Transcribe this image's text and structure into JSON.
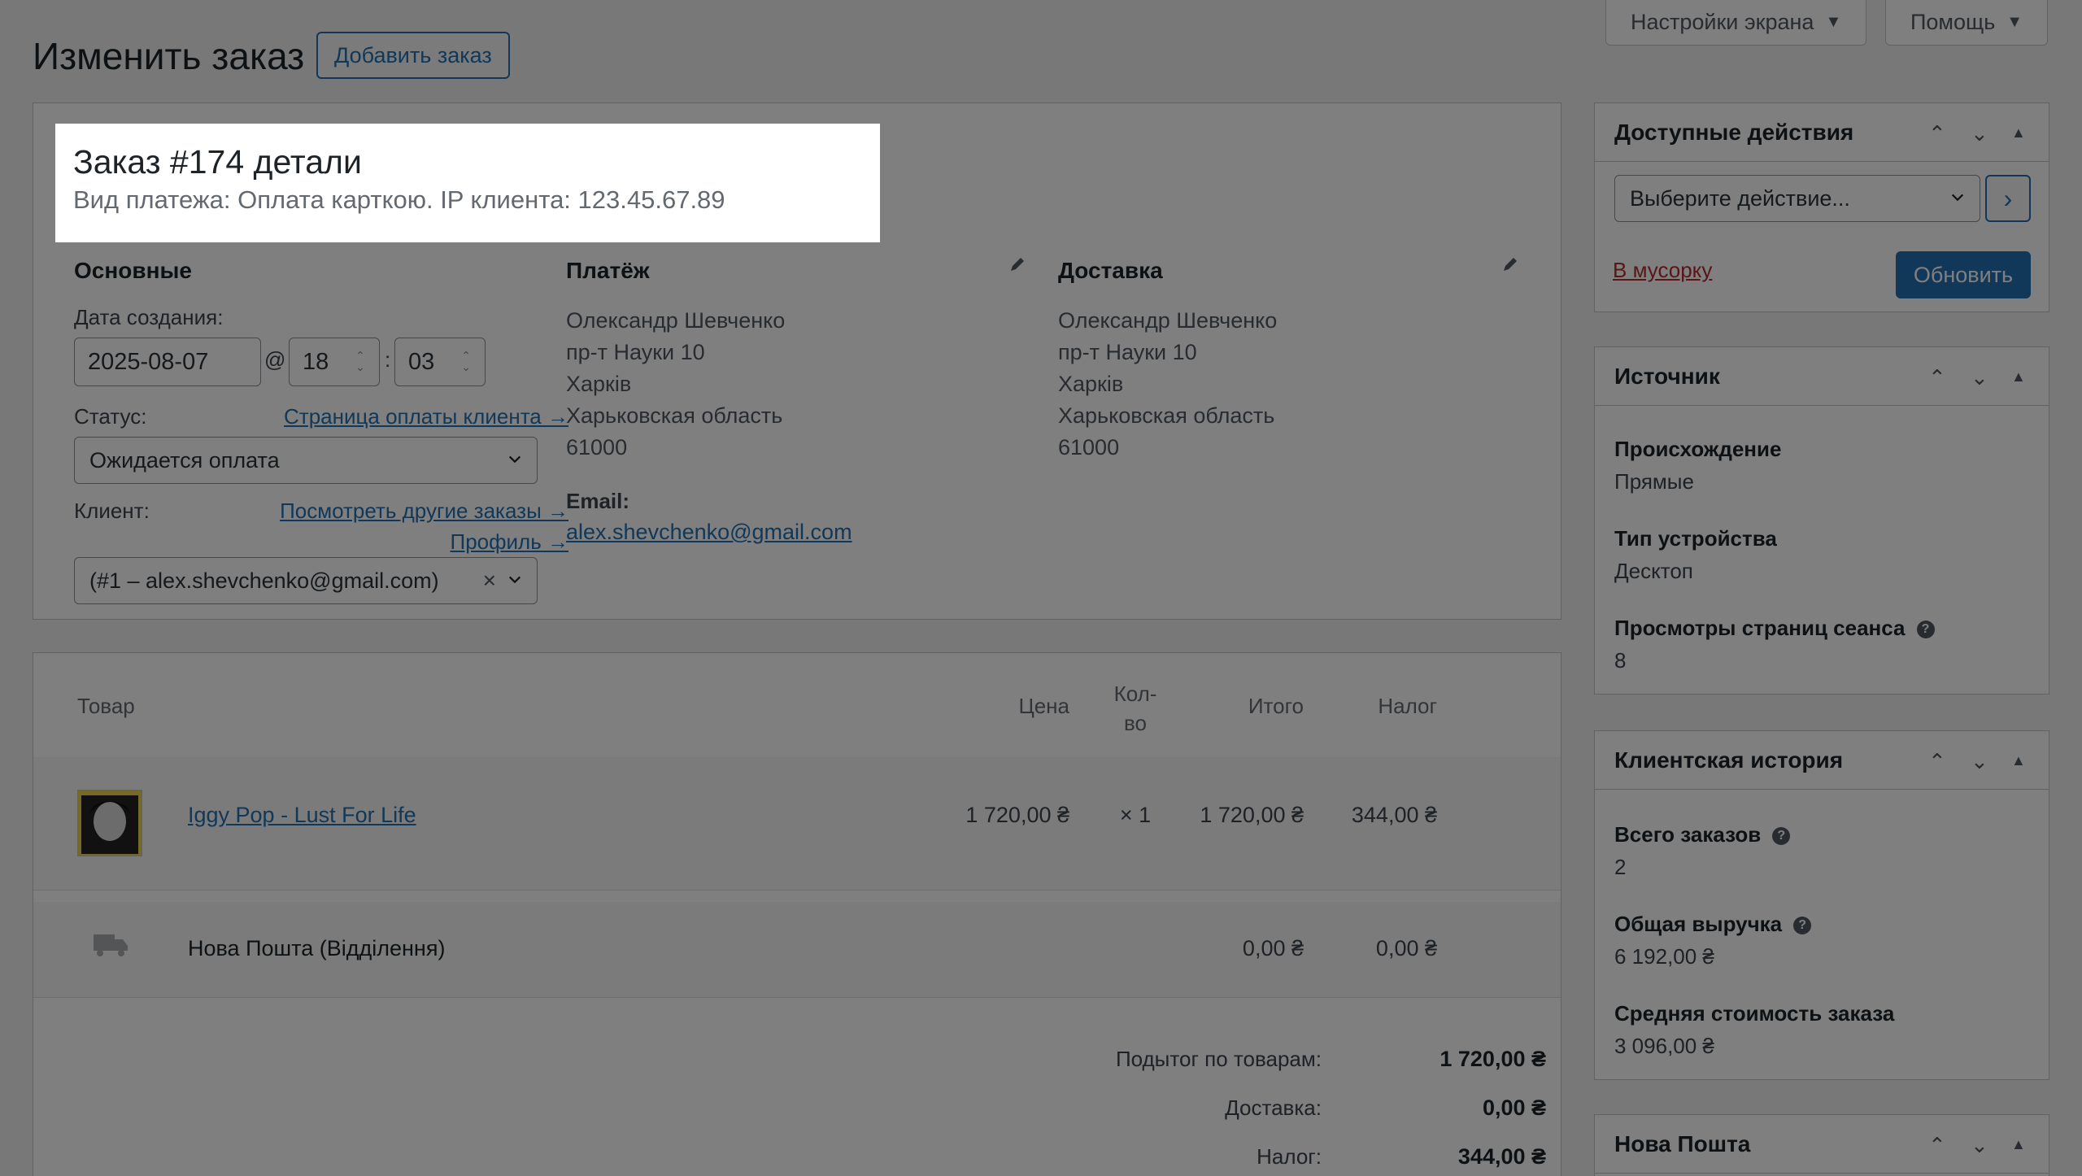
{
  "header": {
    "page_title": "Изменить заказ",
    "add_order_button": "Добавить заказ",
    "screen_options": "Настройки экрана",
    "help": "Помощь"
  },
  "order": {
    "title": "Заказ #174 детали",
    "subtitle": "Вид платежа: Оплата карткою. IP клиента: 123.45.67.89",
    "general": {
      "heading": "Основные",
      "date_label": "Дата создания:",
      "date": "2025-08-07",
      "at": "@",
      "hour": "18",
      "colon": ":",
      "minute": "03",
      "status_label": "Статус:",
      "payment_page_link": "Страница оплаты клиента →",
      "status_value": "Ожидается оплата",
      "customer_label": "Клиент:",
      "other_orders_link": "Посмотреть другие заказы →",
      "profile_link": "Профиль →",
      "customer_value": "(#1 – alex.shevchenko@gmail.com)",
      "clear": "×"
    },
    "billing": {
      "heading": "Платёж",
      "lines": [
        "Олександр Шевченко",
        "пр-т Науки 10",
        "Харків",
        "Харьковская область",
        "61000"
      ],
      "email_label": "Email:",
      "email": "alex.shevchenko@gmail.com"
    },
    "shipping": {
      "heading": "Доставка",
      "lines": [
        "Олександр Шевченко",
        "пр-т Науки 10",
        "Харків",
        "Харьковская область",
        "61000"
      ]
    }
  },
  "items": {
    "headers": {
      "product": "Товар",
      "price": "Цена",
      "qty_1": "Кол-",
      "qty_2": "во",
      "total": "Итого",
      "tax": "Налог"
    },
    "rows": [
      {
        "name": "Iggy Pop - Lust For Life",
        "price": "1 720,00 ₴",
        "qty": "× 1",
        "total": "1 720,00 ₴",
        "tax": "344,00 ₴"
      }
    ],
    "shipping_row": {
      "name": "Нова Пошта (Відділення)",
      "total": "0,00 ₴",
      "tax": "0,00 ₴"
    },
    "summary": [
      {
        "label": "Подытог по товарам:",
        "value": "1 720,00 ₴"
      },
      {
        "label": "Доставка:",
        "value": "0,00 ₴"
      },
      {
        "label": "Налог:",
        "value": "344,00 ₴"
      }
    ]
  },
  "sidebar": {
    "actions": {
      "title": "Доступные действия",
      "select_value": "Выберите действие...",
      "go": "›",
      "trash": "В мусорку",
      "update": "Обновить"
    },
    "source": {
      "title": "Источник",
      "fields": [
        {
          "label": "Происхождение",
          "value": "Прямые"
        },
        {
          "label": "Тип устройства",
          "value": "Десктоп"
        },
        {
          "label": "Просмотры страниц сеанса",
          "value": "8"
        }
      ]
    },
    "history": {
      "title": "Клиентская история",
      "fields": [
        {
          "label": "Всего заказов",
          "value": "2"
        },
        {
          "label": "Общая выручка",
          "value": "6 192,00 ₴"
        },
        {
          "label": "Средняя стоимость заказа",
          "value": "3 096,00 ₴"
        }
      ]
    },
    "nova": {
      "title": "Нова Пошта"
    },
    "controls": {
      "up": "⌃",
      "down": "⌄",
      "toggle": "▲"
    }
  },
  "colors": {
    "accent": "#2271b1",
    "update_bg": "#135e96",
    "trash": "#b32d2e"
  }
}
